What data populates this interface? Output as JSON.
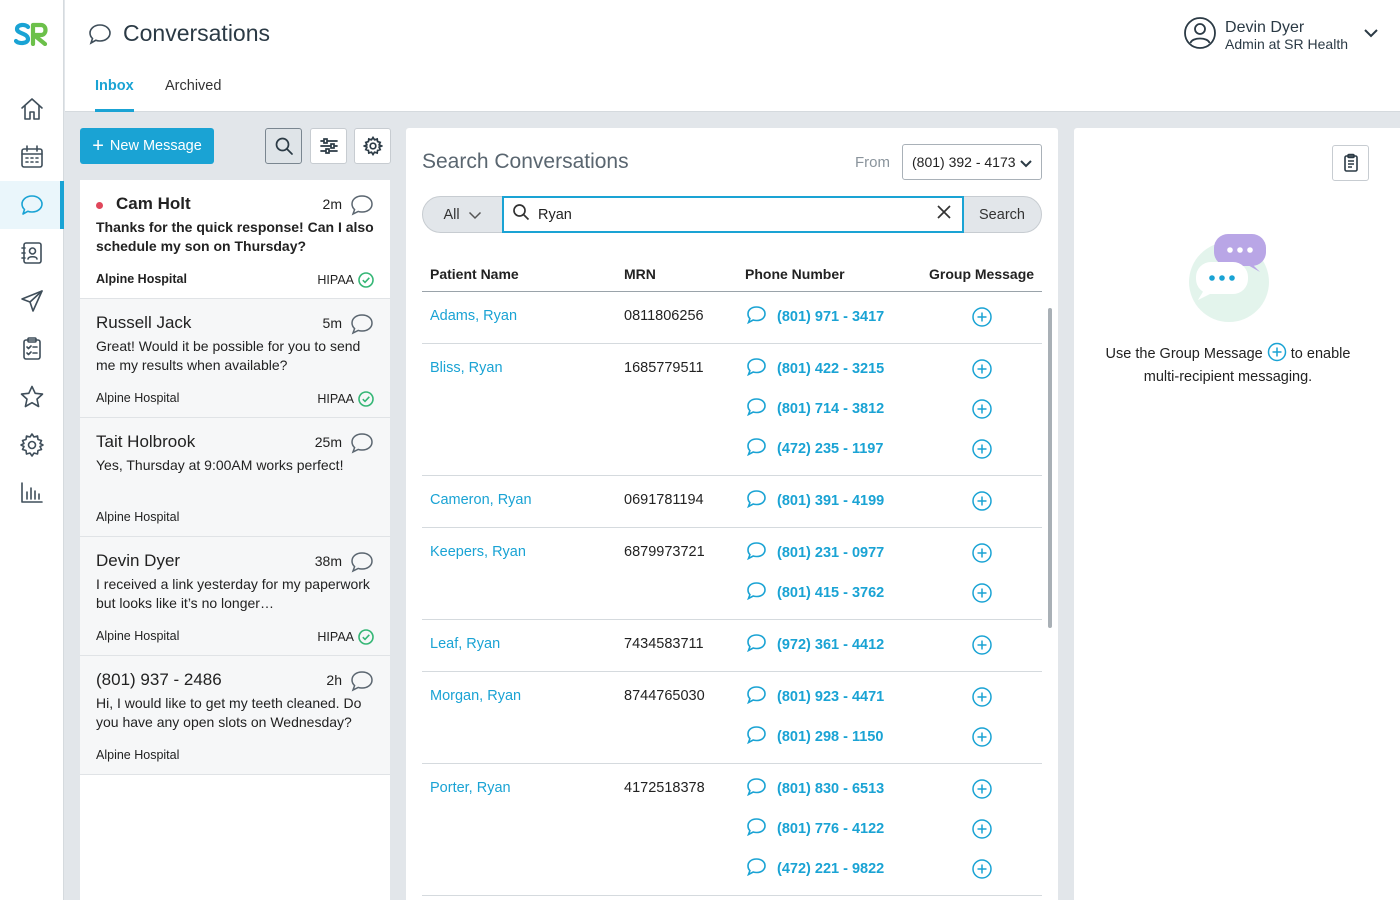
{
  "app": {
    "logo_text": "SR",
    "brand_color": "#1aa3d4"
  },
  "nav": [
    {
      "name": "home-icon",
      "active": false
    },
    {
      "name": "calendar-icon",
      "active": false
    },
    {
      "name": "conversations-icon",
      "active": true
    },
    {
      "name": "contacts-icon",
      "active": false
    },
    {
      "name": "send-icon",
      "active": false
    },
    {
      "name": "clipboard-icon",
      "active": false
    },
    {
      "name": "star-icon",
      "active": false
    },
    {
      "name": "settings-icon",
      "active": false
    },
    {
      "name": "reports-icon",
      "active": false
    }
  ],
  "header": {
    "title": "Conversations",
    "tabs": [
      {
        "label": "Inbox",
        "active": true
      },
      {
        "label": "Archived",
        "active": false
      }
    ],
    "user": {
      "name": "Devin Dyer",
      "role": "Admin at SR Health"
    }
  },
  "toolbar": {
    "new_message_label": "New Message"
  },
  "conversations": [
    {
      "name": "Cam Holt",
      "time": "2m",
      "message": "Thanks for the quick response! Can I also schedule my son on Thursday?",
      "org": "Alpine Hospital",
      "hipaa": "HIPAA",
      "unread": true
    },
    {
      "name": "Russell Jack",
      "time": "5m",
      "message": "Great! Would it be possible for you to send me my results when available?",
      "org": "Alpine Hospital",
      "hipaa": "HIPAA",
      "unread": false
    },
    {
      "name": "Tait Holbrook",
      "time": "25m",
      "message": "Yes, Thursday at 9:00AM works perfect!",
      "org": "Alpine Hospital",
      "hipaa": "",
      "unread": false
    },
    {
      "name": "Devin Dyer",
      "time": "38m",
      "message": "I received a link yesterday for my paperwork but looks like it’s no longer…",
      "org": "Alpine Hospital",
      "hipaa": "HIPAA",
      "unread": false
    },
    {
      "name": "(801) 937 - 2486",
      "time": "2h",
      "message": "Hi, I would like to get my teeth cleaned. Do you have any open slots on Wednesday?",
      "org": "Alpine Hospital",
      "hipaa": "",
      "unread": false
    }
  ],
  "search": {
    "title": "Search Conversations",
    "from_label": "From",
    "from_value": "(801) 392 - 4173",
    "filter": "All",
    "query": "Ryan",
    "button_label": "Search",
    "columns": [
      "Patient Name",
      "MRN",
      "Phone Number",
      "Group Message"
    ],
    "results": [
      {
        "name": "Adams, Ryan",
        "mrn": "0811806256",
        "phones": [
          "(801) 971 - 3417"
        ]
      },
      {
        "name": "Bliss, Ryan",
        "mrn": "1685779511",
        "phones": [
          "(801) 422 - 3215",
          "(801) 714 - 3812",
          "(472) 235 - 1197"
        ]
      },
      {
        "name": "Cameron, Ryan",
        "mrn": "0691781194",
        "phones": [
          "(801) 391 - 4199"
        ]
      },
      {
        "name": "Keepers, Ryan",
        "mrn": "6879973721",
        "phones": [
          "(801) 231 - 0977",
          "(801) 415 - 3762"
        ]
      },
      {
        "name": "Leaf, Ryan",
        "mrn": "7434583711",
        "phones": [
          "(972) 361 - 4412"
        ]
      },
      {
        "name": "Morgan, Ryan",
        "mrn": "8744765030",
        "phones": [
          "(801) 923 - 4471",
          "(801) 298 - 1150"
        ]
      },
      {
        "name": "Porter, Ryan",
        "mrn": "4172518378",
        "phones": [
          "(801) 830 - 6513",
          "(801) 776 - 4122",
          "(472) 221 - 9822"
        ]
      }
    ]
  },
  "right_panel": {
    "text_before": "Use the Group Message",
    "text_after": "to enable multi-recipient messaging."
  }
}
